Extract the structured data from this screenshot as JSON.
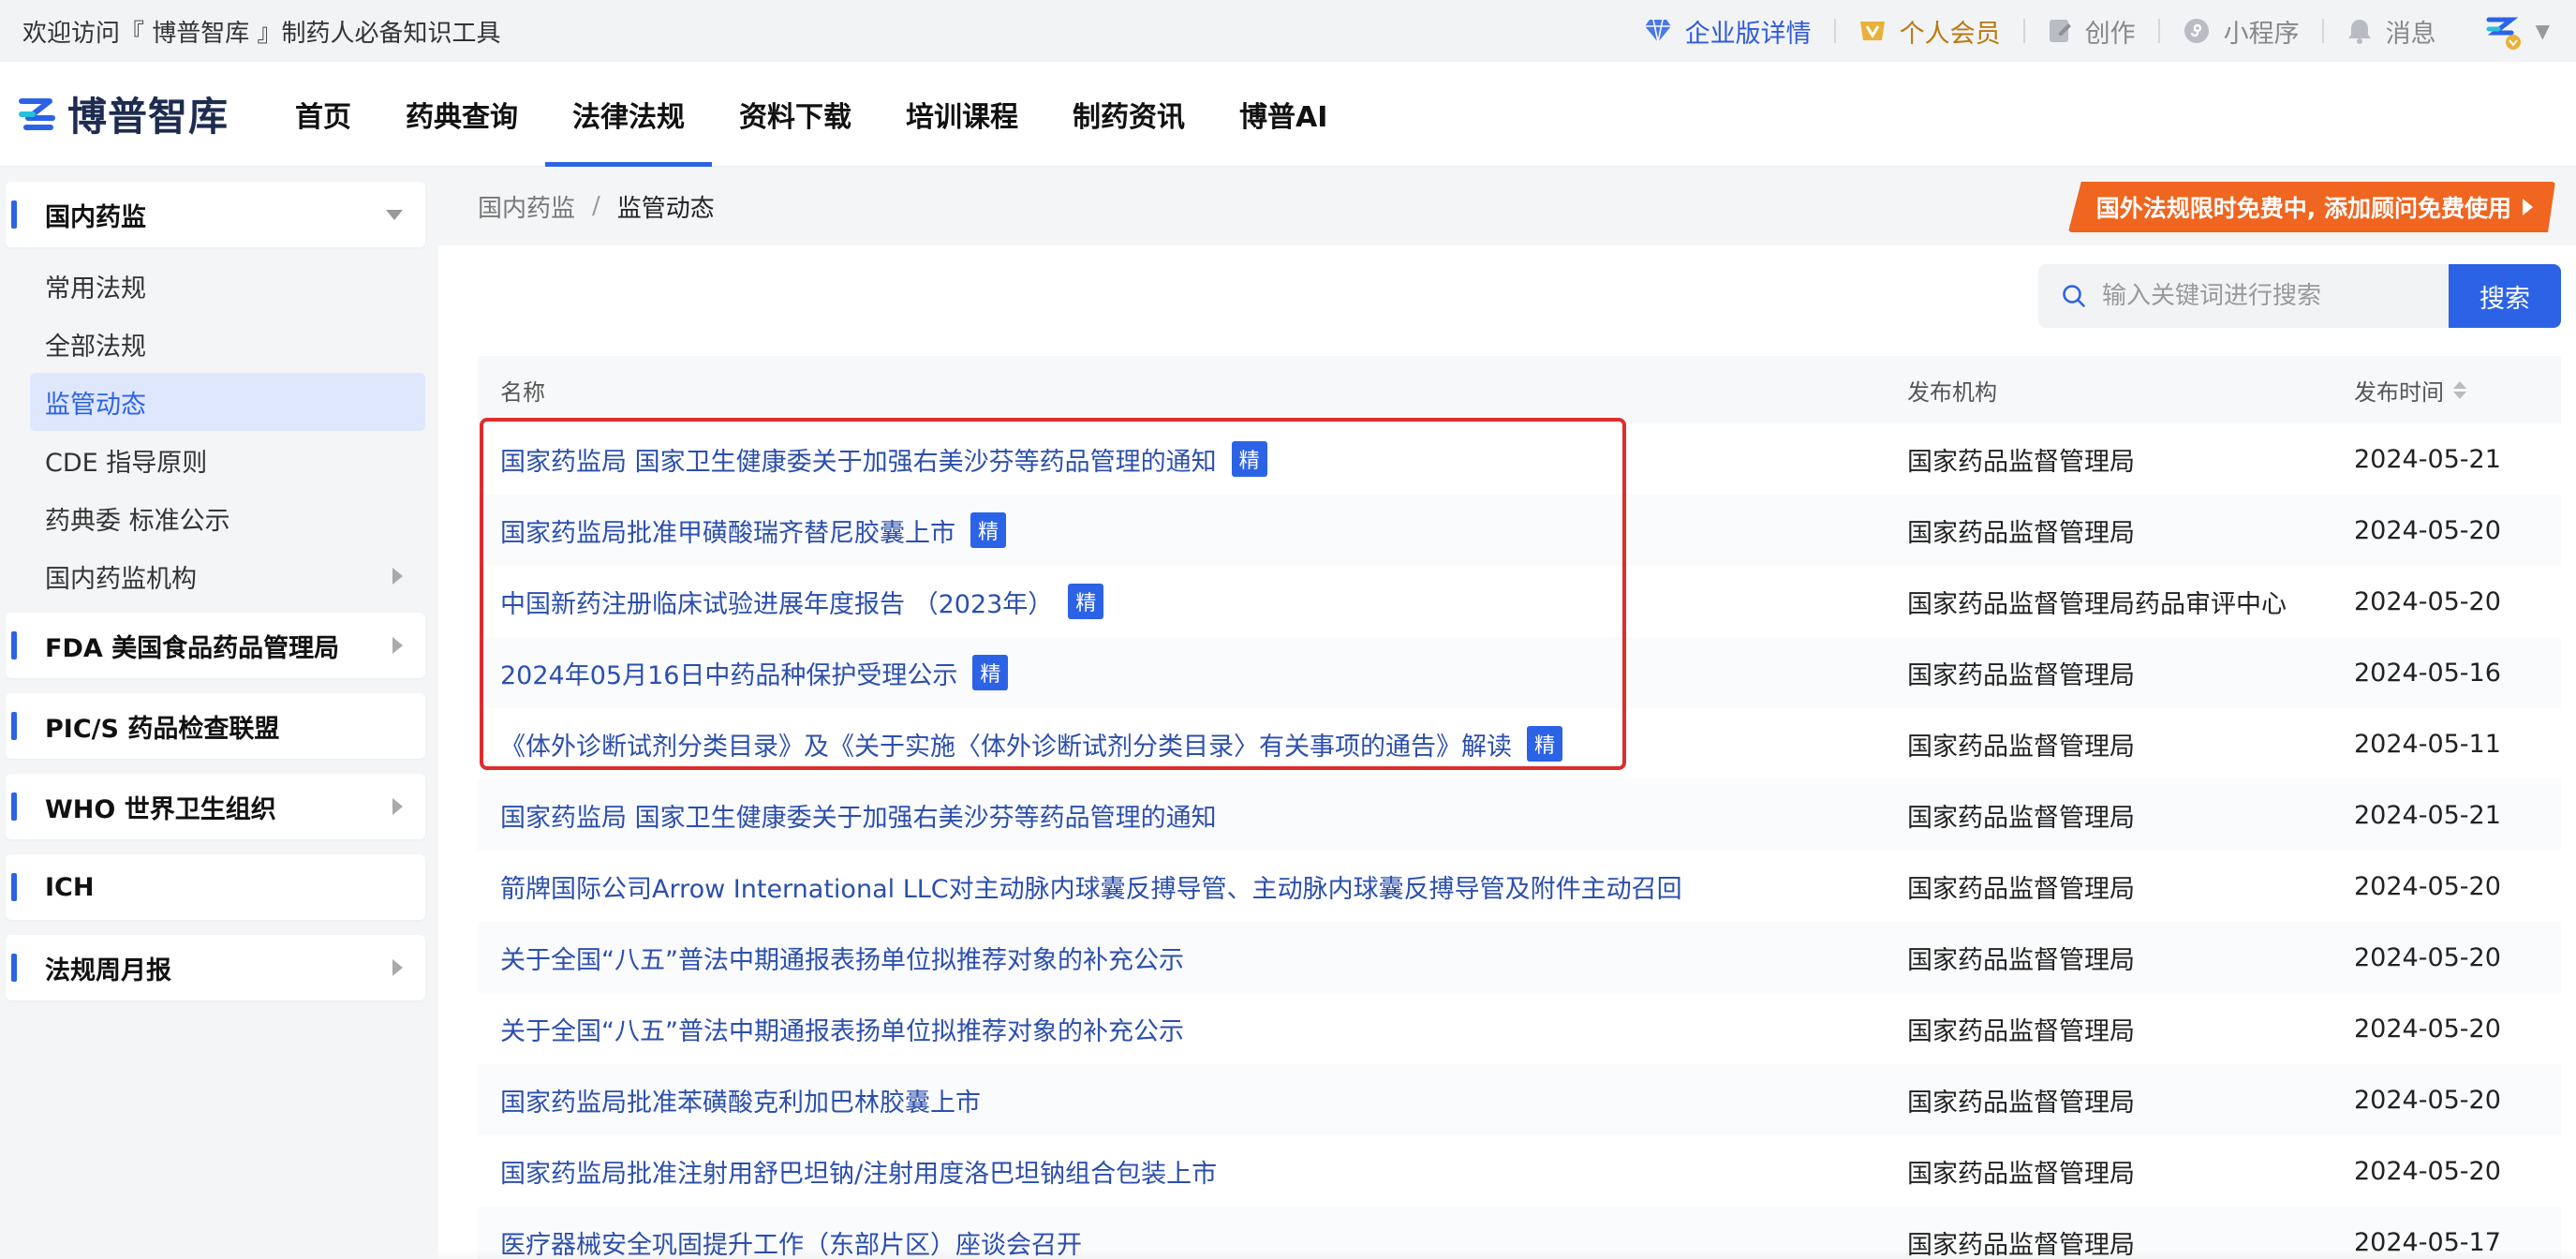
{
  "topbar": {
    "welcome": "欢迎访问『 博普智库 』制药人必备知识工具",
    "enterprise": "企业版详情",
    "vip": "个人会员",
    "create": "创作",
    "miniprogram": "小程序",
    "messages": "消息"
  },
  "nav": {
    "logo_text": "博普智库",
    "items": [
      "首页",
      "药典查询",
      "法律法规",
      "资料下载",
      "培训课程",
      "制药资讯",
      "博普AI"
    ],
    "active_index": 2
  },
  "sidebar": {
    "groups": [
      "国内药监",
      "FDA 美国食品药品管理局",
      "PIC/S 药品检查联盟",
      "WHO 世界卫生组织",
      "ICH",
      "法规周月报"
    ],
    "sub_items": [
      "常用法规",
      "全部法规",
      "监管动态",
      "CDE 指导原则",
      "药典委 标准公示",
      "国内药监机构"
    ],
    "active_sub": "监管动态"
  },
  "breadcrumb": {
    "parent": "国内药监",
    "separator": "/",
    "current": "监管动态"
  },
  "promo": {
    "text": "国外法规限时免费中, 添加顾问免费使用"
  },
  "search": {
    "placeholder": "输入关键词进行搜索",
    "button": "搜索"
  },
  "table": {
    "headers": {
      "name": "名称",
      "org": "发布机构",
      "date": "发布时间"
    },
    "badge_label": "精",
    "rows": [
      {
        "title": "国家药监局 国家卫生健康委关于加强右美沙芬等药品管理的通知",
        "featured": true,
        "org": "国家药品监督管理局",
        "date": "2024-05-21"
      },
      {
        "title": "国家药监局批准甲磺酸瑞齐替尼胶囊上市",
        "featured": true,
        "org": "国家药品监督管理局",
        "date": "2024-05-20"
      },
      {
        "title": "中国新药注册临床试验进展年度报告 （2023年）",
        "featured": true,
        "org": "国家药品监督管理局药品审评中心",
        "date": "2024-05-20"
      },
      {
        "title": "2024年05月16日中药品种保护受理公示",
        "featured": true,
        "org": "国家药品监督管理局",
        "date": "2024-05-16"
      },
      {
        "title": "《体外诊断试剂分类目录》及《关于实施〈体外诊断试剂分类目录〉有关事项的通告》解读",
        "featured": true,
        "org": "国家药品监督管理局",
        "date": "2024-05-11"
      },
      {
        "title": "国家药监局 国家卫生健康委关于加强右美沙芬等药品管理的通知",
        "featured": false,
        "org": "国家药品监督管理局",
        "date": "2024-05-21"
      },
      {
        "title": "箭牌国际公司Arrow International LLC对主动脉内球囊反搏导管、主动脉内球囊反搏导管及附件主动召回",
        "featured": false,
        "org": "国家药品监督管理局",
        "date": "2024-05-20"
      },
      {
        "title": "关于全国“八五”普法中期通报表扬单位拟推荐对象的补充公示",
        "featured": false,
        "org": "国家药品监督管理局",
        "date": "2024-05-20"
      },
      {
        "title": "关于全国“八五”普法中期通报表扬单位拟推荐对象的补充公示",
        "featured": false,
        "org": "国家药品监督管理局",
        "date": "2024-05-20"
      },
      {
        "title": "国家药监局批准苯磺酸克利加巴林胶囊上市",
        "featured": false,
        "org": "国家药品监督管理局",
        "date": "2024-05-20"
      },
      {
        "title": "国家药监局批准注射用舒巴坦钠/注射用度洛巴坦钠组合包装上市",
        "featured": false,
        "org": "国家药品监督管理局",
        "date": "2024-05-20"
      },
      {
        "title": "医疗器械安全巩固提升工作（东部片区）座谈会召开",
        "featured": false,
        "org": "国家药品监督管理局",
        "date": "2024-05-17"
      }
    ]
  },
  "colors": {
    "accent": "#2c63e6",
    "promo": "#f0651f",
    "link": "#2c4fae",
    "highlight": "#e02c2c"
  }
}
